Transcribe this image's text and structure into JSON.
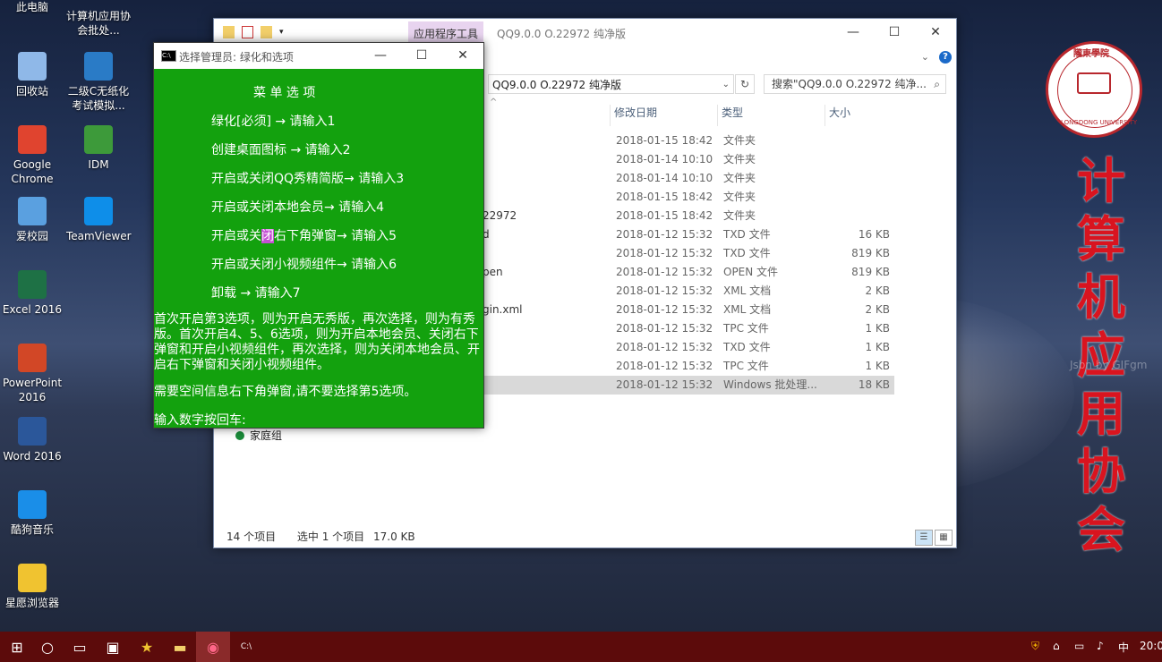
{
  "desktop": {
    "icons": [
      {
        "label": "此电脑",
        "icon": "computer-icon",
        "color": "#3b7dd8"
      },
      {
        "label": "计算机应用协会批处...",
        "icon": "batch-file-icon",
        "color": "#6b6b6b"
      },
      {
        "label": "回收站",
        "icon": "recycle-bin-icon",
        "color": "#8fb8e8"
      },
      {
        "label": "二级C无纸化考试模拟...",
        "icon": "exam-simulator-icon",
        "color": "#2a7bc6"
      },
      {
        "label": "Google Chrome",
        "icon": "chrome-icon",
        "color": "#e0442f"
      },
      {
        "label": "IDM",
        "icon": "idm-icon",
        "color": "#3d9a3a"
      },
      {
        "label": "爱校园",
        "icon": "campus-app-icon",
        "color": "#5aa0e0"
      },
      {
        "label": "TeamViewer",
        "icon": "teamviewer-icon",
        "color": "#0e8ee9"
      },
      {
        "label": "Excel 2016",
        "icon": "excel-icon",
        "color": "#1e7145"
      },
      {
        "label": "PowerPoint 2016",
        "icon": "powerpoint-icon",
        "color": "#d24726"
      },
      {
        "label": "Word 2016",
        "icon": "word-icon",
        "color": "#2b579a"
      },
      {
        "label": "酷狗音乐",
        "icon": "kugou-icon",
        "color": "#1a8ee8"
      },
      {
        "label": "星愿浏览器",
        "icon": "star-browser-icon",
        "color": "#f0c330"
      }
    ],
    "logo_text": "隴東學院",
    "logo_subtext": "LONGDONG UNIVERSITY",
    "vertical_title": "计算机应用协会"
  },
  "explorer": {
    "ribbon_context_tab": "应用程序工具",
    "window_title": "QQ9.0.0 O.22972 纯净版",
    "address": "QQ9.0.0 O.22972 纯净版",
    "search_placeholder": "搜索\"QQ9.0.0 O.22972 纯净...",
    "columns": {
      "date": "修改日期",
      "type": "类型",
      "size": "大小"
    },
    "rows": [
      {
        "name": "",
        "date": "2018-01-15 18:42",
        "type": "文件夹",
        "size": ""
      },
      {
        "name": "",
        "date": "2018-01-14 10:10",
        "type": "文件夹",
        "size": ""
      },
      {
        "name": "",
        "date": "2018-01-14 10:10",
        "type": "文件夹",
        "size": ""
      },
      {
        "name": "",
        "date": "2018-01-15 18:42",
        "type": "文件夹",
        "size": ""
      },
      {
        "name": "22972",
        "date": "2018-01-15 18:42",
        "type": "文件夹",
        "size": ""
      },
      {
        "name": "d",
        "date": "2018-01-12 15:32",
        "type": "TXD 文件",
        "size": "16 KB"
      },
      {
        "name": "",
        "date": "2018-01-12 15:32",
        "type": "TXD 文件",
        "size": "819 KB"
      },
      {
        "name": "pen",
        "date": "2018-01-12 15:32",
        "type": "OPEN 文件",
        "size": "819 KB"
      },
      {
        "name": "",
        "date": "2018-01-12 15:32",
        "type": "XML 文档",
        "size": "2 KB"
      },
      {
        "name": "gin.xml",
        "date": "2018-01-12 15:32",
        "type": "XML 文档",
        "size": "2 KB"
      },
      {
        "name": "",
        "date": "2018-01-12 15:32",
        "type": "TPC 文件",
        "size": "1 KB"
      },
      {
        "name": "",
        "date": "2018-01-12 15:32",
        "type": "TXD 文件",
        "size": "1 KB"
      },
      {
        "name": "",
        "date": "2018-01-12 15:32",
        "type": "TPC 文件",
        "size": "1 KB"
      },
      {
        "name": "",
        "date": "2018-01-12 15:32",
        "type": "Windows 批处理...",
        "size": "18 KB"
      }
    ],
    "selected_row": 13,
    "nav_homegroup": "家庭组",
    "status_count": "14 个项目",
    "status_selected": "选中 1 个项目",
    "status_size": "17.0 KB"
  },
  "cmd": {
    "title": "选择管理员:  绿化和选项",
    "menu_title": "菜 单 选 项",
    "items": [
      "绿化[必须] → 请输入1",
      "创建桌面图标 → 请输入2",
      "开启或关闭QQ秀精简版→ 请输入3",
      "开启或关闭本地会员→ 请输入4",
      "开启或关闭右下角弹窗→ 请输入5",
      "开启或关闭小视频组件→ 请输入6",
      "卸载 → 请输入7"
    ],
    "item5_pre": "开启或关",
    "item5_sel": "闭",
    "item5_post": "右下角弹窗→ 请输入5",
    "note1": "首次开启第3选项，则为开启无秀版，再次选择，则为有秀版。首次开启4、5、6选项，则为开启本地会员、关闭右下弹窗和开启小视频组件，再次选择，则为关闭本地会员、开启右下弹窗和关闭小视频组件。",
    "note2": "需要空间信息右下角弹窗,请不要选择第5选项。",
    "prompt": "输入数字按回车:"
  },
  "watermark": "Jsbn by GIFgm",
  "taskbar": {
    "clock": "20:0",
    "ime": "中"
  }
}
